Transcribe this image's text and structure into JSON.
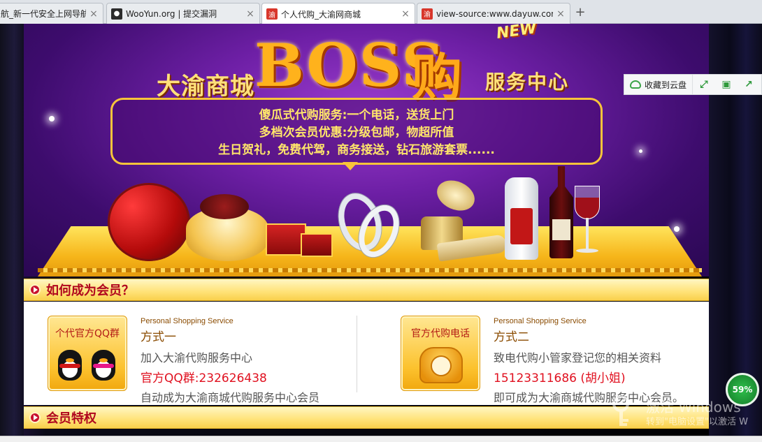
{
  "browser": {
    "tabs": [
      {
        "title": "航_新一代安全上网导航",
        "favicon": "none",
        "active": false
      },
      {
        "title": "WooYun.org | 提交漏洞",
        "favicon": "wooyun-icon",
        "active": false
      },
      {
        "title": "个人代购_大渝网商城",
        "favicon": "dayu-icon",
        "favicon_text": "渝",
        "active": true
      },
      {
        "title": "view-source:www.dayuw.com",
        "favicon": "dayu-icon",
        "favicon_text": "渝",
        "active": false
      }
    ],
    "tab_close": "×",
    "new_tab": "+"
  },
  "banner": {
    "new_badge": "NEW",
    "brand_left": "大渝商城",
    "boss": "BOSS",
    "gou": "购",
    "brand_right": "服务中心",
    "bubble_lines": [
      "傻瓜式代购服务:一个电话，送货上门",
      "多档次会员优惠:分级包邮，物超所值",
      "生日贺礼，免费代驾，商务接送，钻石旅游套票......"
    ]
  },
  "cloud_toolbar": {
    "save_label": "收藏到云盘",
    "btn_expand": "⤢",
    "btn_save": "▣",
    "btn_share": "↗"
  },
  "section_member": {
    "title": "如何成为会员？"
  },
  "way1": {
    "box_caption": "个代官方QQ群",
    "en": "Personal Shopping Service",
    "name": "方式一",
    "line1": "加入大渝代购服务中心",
    "line2": "官方QQ群:232626438",
    "line3": "自动成为大渝商城代购服务中心会员"
  },
  "way2": {
    "box_caption": "官方代购电话",
    "en": "Personal Shopping Service",
    "name": "方式二",
    "line1": "致电代购小管家登记您的相关资料",
    "line2": "15123311686 (胡小姐)",
    "line3": "即可成为大渝商城代购服务中心会员。"
  },
  "section_privilege": {
    "title": "会员特权"
  },
  "watermark": {
    "line1": "激活 Windows",
    "line2": "转到\"电脑设置\"以激活 W"
  },
  "speed_widget": {
    "value": "59%"
  },
  "colors": {
    "banner_purple": "#6d1fa5",
    "gold": "#ffb21c",
    "accent_red": "#e0101f",
    "section_bar": "#ffe277"
  }
}
